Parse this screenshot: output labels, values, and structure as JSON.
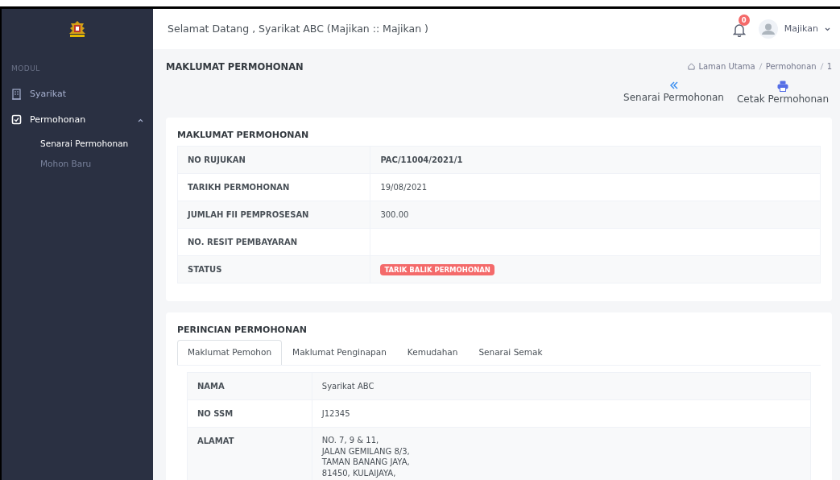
{
  "header": {
    "welcome": "Selamat Datang , Syarikat ABC (Majikan :: Majikan )",
    "notification_count": "0",
    "user": "Majikan"
  },
  "sidebar": {
    "section": "MODUL",
    "items": [
      {
        "label": "Syarikat",
        "expanded": false
      },
      {
        "label": "Permohonan",
        "expanded": true,
        "children": [
          {
            "label": "Senarai Permohonan",
            "selected": true
          },
          {
            "label": "Mohon Baru",
            "selected": false
          }
        ]
      }
    ]
  },
  "page": {
    "title": "MAKLUMAT PERMOHONAN",
    "breadcrumb": [
      "Laman Utama",
      "Permohonan",
      "1"
    ],
    "actions": [
      {
        "label": "Senarai Permohonan"
      },
      {
        "label": "Cetak Permohonan"
      }
    ]
  },
  "summary": {
    "title": "MAKLUMAT PERMOHONAN",
    "rows": [
      {
        "label": "NO RUJUKAN",
        "value": "PAC/11004/2021/1",
        "kind": "bold"
      },
      {
        "label": "TARIKH PERMOHONAN",
        "value": "19/08/2021",
        "kind": "text"
      },
      {
        "label": "JUMLAH FII PEMPROSESAN",
        "value": "300.00",
        "kind": "text"
      },
      {
        "label": "NO. RESIT PEMBAYARAN",
        "kind": "empty"
      },
      {
        "label": "STATUS",
        "value": "TARIK BALIK PERMOHONAN",
        "kind": "badge",
        "color": "#f46a6a"
      }
    ]
  },
  "details": {
    "title": "PERINCIAN PERMOHONAN",
    "tabs": [
      {
        "label": "Maklumat Pemohon",
        "selected": true
      },
      {
        "label": "Maklumat Penginapan",
        "selected": false
      },
      {
        "label": "Kemudahan",
        "selected": false
      },
      {
        "label": "Senarai Semak",
        "selected": false
      }
    ],
    "rows": [
      {
        "label": "NAMA",
        "lines": [
          "Syarikat ABC"
        ]
      },
      {
        "label": "NO SSM",
        "lines": [
          "J12345"
        ]
      },
      {
        "label": "ALAMAT",
        "lines": [
          "NO. 7, 9 & 11,",
          "JALAN GEMILANG 8/3,",
          "TAMAN BANANG JAYA,",
          "81450, KULAIJAYA,"
        ]
      }
    ]
  }
}
